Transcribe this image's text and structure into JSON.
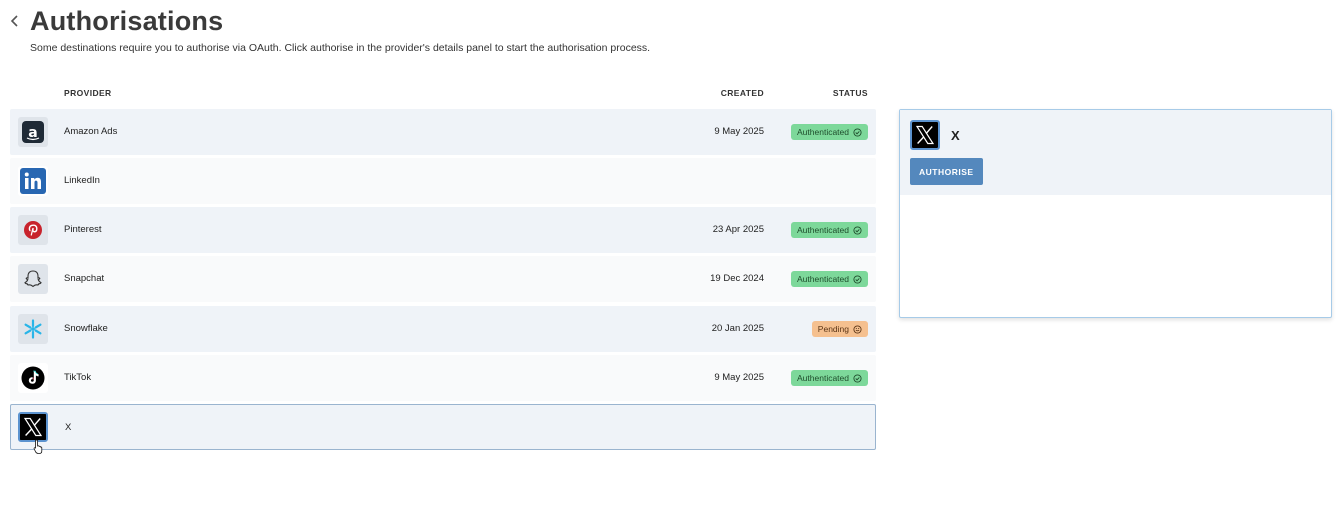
{
  "page": {
    "title": "Authorisations",
    "subtitle": "Some destinations require you to authorise via OAuth. Click authorise in the provider's details panel to start the authorisation process."
  },
  "table": {
    "columns": {
      "provider": "PROVIDER",
      "created": "CREATED",
      "status": "STATUS"
    },
    "rows": [
      {
        "name": "Amazon Ads",
        "created": "9 May 2025",
        "status": "Authenticated",
        "status_type": "authenticated",
        "logo": "amazon-logo"
      },
      {
        "name": "LinkedIn",
        "created": "",
        "status": "",
        "status_type": "none",
        "logo": "linkedin-logo"
      },
      {
        "name": "Pinterest",
        "created": "23 Apr 2025",
        "status": "Authenticated",
        "status_type": "authenticated",
        "logo": "pinterest-logo"
      },
      {
        "name": "Snapchat",
        "created": "19 Dec 2024",
        "status": "Authenticated",
        "status_type": "authenticated",
        "logo": "snapchat-logo"
      },
      {
        "name": "Snowflake",
        "created": "20 Jan 2025",
        "status": "Pending",
        "status_type": "pending",
        "logo": "snowflake-logo"
      },
      {
        "name": "TikTok",
        "created": "9 May 2025",
        "status": "Authenticated",
        "status_type": "authenticated",
        "logo": "tiktok-logo"
      },
      {
        "name": "X",
        "created": "",
        "status": "",
        "status_type": "none",
        "logo": "x-logo",
        "selected": true
      }
    ]
  },
  "detail": {
    "name": "X",
    "logo": "x-logo",
    "authorise_label": "AUTHORISE"
  },
  "colors": {
    "authenticated_bg": "#7dd89a",
    "pending_bg": "#f5c08f",
    "accent": "#5488bd",
    "row_alt": "#eff3f8"
  }
}
